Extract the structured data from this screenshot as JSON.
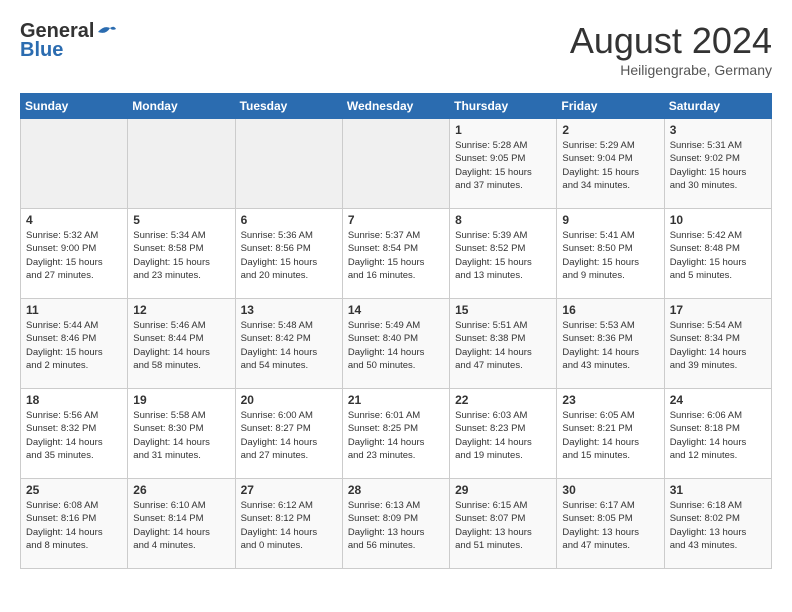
{
  "header": {
    "logo_general": "General",
    "logo_blue": "Blue",
    "title": "August 2024",
    "subtitle": "Heiligengrabe, Germany"
  },
  "days_of_week": [
    "Sunday",
    "Monday",
    "Tuesday",
    "Wednesday",
    "Thursday",
    "Friday",
    "Saturday"
  ],
  "weeks": [
    [
      {
        "day": "",
        "info": ""
      },
      {
        "day": "",
        "info": ""
      },
      {
        "day": "",
        "info": ""
      },
      {
        "day": "",
        "info": ""
      },
      {
        "day": "1",
        "info": "Sunrise: 5:28 AM\nSunset: 9:05 PM\nDaylight: 15 hours\nand 37 minutes."
      },
      {
        "day": "2",
        "info": "Sunrise: 5:29 AM\nSunset: 9:04 PM\nDaylight: 15 hours\nand 34 minutes."
      },
      {
        "day": "3",
        "info": "Sunrise: 5:31 AM\nSunset: 9:02 PM\nDaylight: 15 hours\nand 30 minutes."
      }
    ],
    [
      {
        "day": "4",
        "info": "Sunrise: 5:32 AM\nSunset: 9:00 PM\nDaylight: 15 hours\nand 27 minutes."
      },
      {
        "day": "5",
        "info": "Sunrise: 5:34 AM\nSunset: 8:58 PM\nDaylight: 15 hours\nand 23 minutes."
      },
      {
        "day": "6",
        "info": "Sunrise: 5:36 AM\nSunset: 8:56 PM\nDaylight: 15 hours\nand 20 minutes."
      },
      {
        "day": "7",
        "info": "Sunrise: 5:37 AM\nSunset: 8:54 PM\nDaylight: 15 hours\nand 16 minutes."
      },
      {
        "day": "8",
        "info": "Sunrise: 5:39 AM\nSunset: 8:52 PM\nDaylight: 15 hours\nand 13 minutes."
      },
      {
        "day": "9",
        "info": "Sunrise: 5:41 AM\nSunset: 8:50 PM\nDaylight: 15 hours\nand 9 minutes."
      },
      {
        "day": "10",
        "info": "Sunrise: 5:42 AM\nSunset: 8:48 PM\nDaylight: 15 hours\nand 5 minutes."
      }
    ],
    [
      {
        "day": "11",
        "info": "Sunrise: 5:44 AM\nSunset: 8:46 PM\nDaylight: 15 hours\nand 2 minutes."
      },
      {
        "day": "12",
        "info": "Sunrise: 5:46 AM\nSunset: 8:44 PM\nDaylight: 14 hours\nand 58 minutes."
      },
      {
        "day": "13",
        "info": "Sunrise: 5:48 AM\nSunset: 8:42 PM\nDaylight: 14 hours\nand 54 minutes."
      },
      {
        "day": "14",
        "info": "Sunrise: 5:49 AM\nSunset: 8:40 PM\nDaylight: 14 hours\nand 50 minutes."
      },
      {
        "day": "15",
        "info": "Sunrise: 5:51 AM\nSunset: 8:38 PM\nDaylight: 14 hours\nand 47 minutes."
      },
      {
        "day": "16",
        "info": "Sunrise: 5:53 AM\nSunset: 8:36 PM\nDaylight: 14 hours\nand 43 minutes."
      },
      {
        "day": "17",
        "info": "Sunrise: 5:54 AM\nSunset: 8:34 PM\nDaylight: 14 hours\nand 39 minutes."
      }
    ],
    [
      {
        "day": "18",
        "info": "Sunrise: 5:56 AM\nSunset: 8:32 PM\nDaylight: 14 hours\nand 35 minutes."
      },
      {
        "day": "19",
        "info": "Sunrise: 5:58 AM\nSunset: 8:30 PM\nDaylight: 14 hours\nand 31 minutes."
      },
      {
        "day": "20",
        "info": "Sunrise: 6:00 AM\nSunset: 8:27 PM\nDaylight: 14 hours\nand 27 minutes."
      },
      {
        "day": "21",
        "info": "Sunrise: 6:01 AM\nSunset: 8:25 PM\nDaylight: 14 hours\nand 23 minutes."
      },
      {
        "day": "22",
        "info": "Sunrise: 6:03 AM\nSunset: 8:23 PM\nDaylight: 14 hours\nand 19 minutes."
      },
      {
        "day": "23",
        "info": "Sunrise: 6:05 AM\nSunset: 8:21 PM\nDaylight: 14 hours\nand 15 minutes."
      },
      {
        "day": "24",
        "info": "Sunrise: 6:06 AM\nSunset: 8:18 PM\nDaylight: 14 hours\nand 12 minutes."
      }
    ],
    [
      {
        "day": "25",
        "info": "Sunrise: 6:08 AM\nSunset: 8:16 PM\nDaylight: 14 hours\nand 8 minutes."
      },
      {
        "day": "26",
        "info": "Sunrise: 6:10 AM\nSunset: 8:14 PM\nDaylight: 14 hours\nand 4 minutes."
      },
      {
        "day": "27",
        "info": "Sunrise: 6:12 AM\nSunset: 8:12 PM\nDaylight: 14 hours\nand 0 minutes."
      },
      {
        "day": "28",
        "info": "Sunrise: 6:13 AM\nSunset: 8:09 PM\nDaylight: 13 hours\nand 56 minutes."
      },
      {
        "day": "29",
        "info": "Sunrise: 6:15 AM\nSunset: 8:07 PM\nDaylight: 13 hours\nand 51 minutes."
      },
      {
        "day": "30",
        "info": "Sunrise: 6:17 AM\nSunset: 8:05 PM\nDaylight: 13 hours\nand 47 minutes."
      },
      {
        "day": "31",
        "info": "Sunrise: 6:18 AM\nSunset: 8:02 PM\nDaylight: 13 hours\nand 43 minutes."
      }
    ]
  ]
}
